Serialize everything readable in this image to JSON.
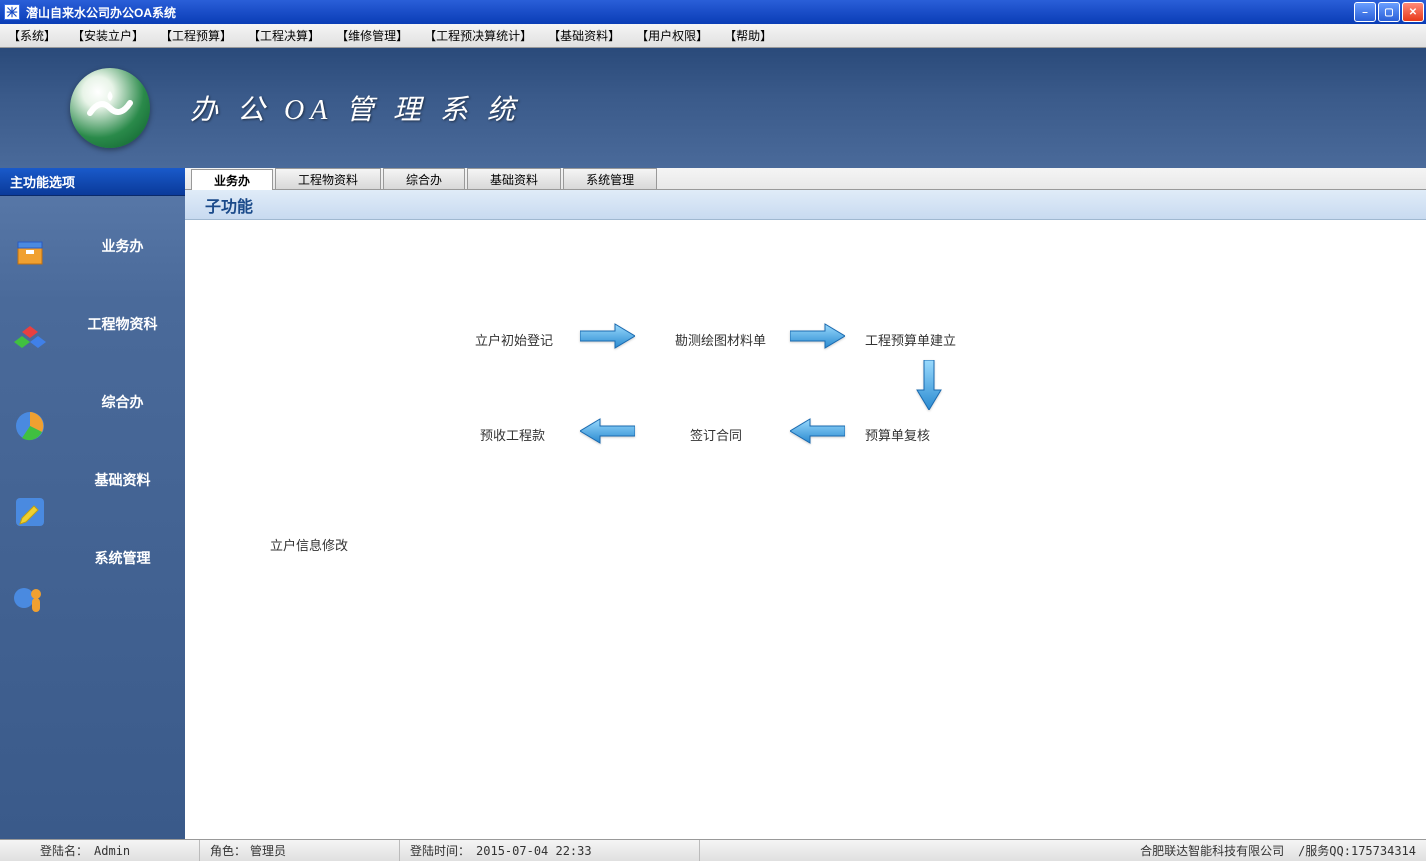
{
  "window": {
    "title": "潜山自来水公司办公OA系统"
  },
  "menubar": [
    "【系统】",
    "【安装立户】",
    "【工程预算】",
    "【工程决算】",
    "【维修管理】",
    "【工程预决算统计】",
    "【基础资料】",
    "【用户权限】",
    "【帮助】"
  ],
  "banner": {
    "title": "办 公 OA 管 理 系 统"
  },
  "sidebar": {
    "header": "主功能选项",
    "items": [
      {
        "label": "业务办"
      },
      {
        "label": "工程物资科"
      },
      {
        "label": "综合办"
      },
      {
        "label": "基础资料"
      },
      {
        "label": "系统管理"
      }
    ]
  },
  "tabs": [
    {
      "label": "业务办",
      "active": true
    },
    {
      "label": "工程物资料",
      "active": false
    },
    {
      "label": "综合办",
      "active": false
    },
    {
      "label": "基础资料",
      "active": false
    },
    {
      "label": "系统管理",
      "active": false
    }
  ],
  "sub_header": "子功能",
  "workflow": {
    "step1": "立户初始登记",
    "step2": "勘测绘图材料单",
    "step3": "工程预算单建立",
    "step4": "预算单复核",
    "step5": "签订合同",
    "step6": "预收工程款",
    "extra": "立户信息修改"
  },
  "statusbar": {
    "login_name_label": "登陆名：",
    "login_name": "Admin",
    "role_label": "角色：",
    "role": "管理员",
    "login_time_label": "登陆时间：",
    "login_time": "2015-07-04 22:33",
    "company": "合肥联达智能科技有限公司",
    "service": "/服务QQ:175734314"
  }
}
